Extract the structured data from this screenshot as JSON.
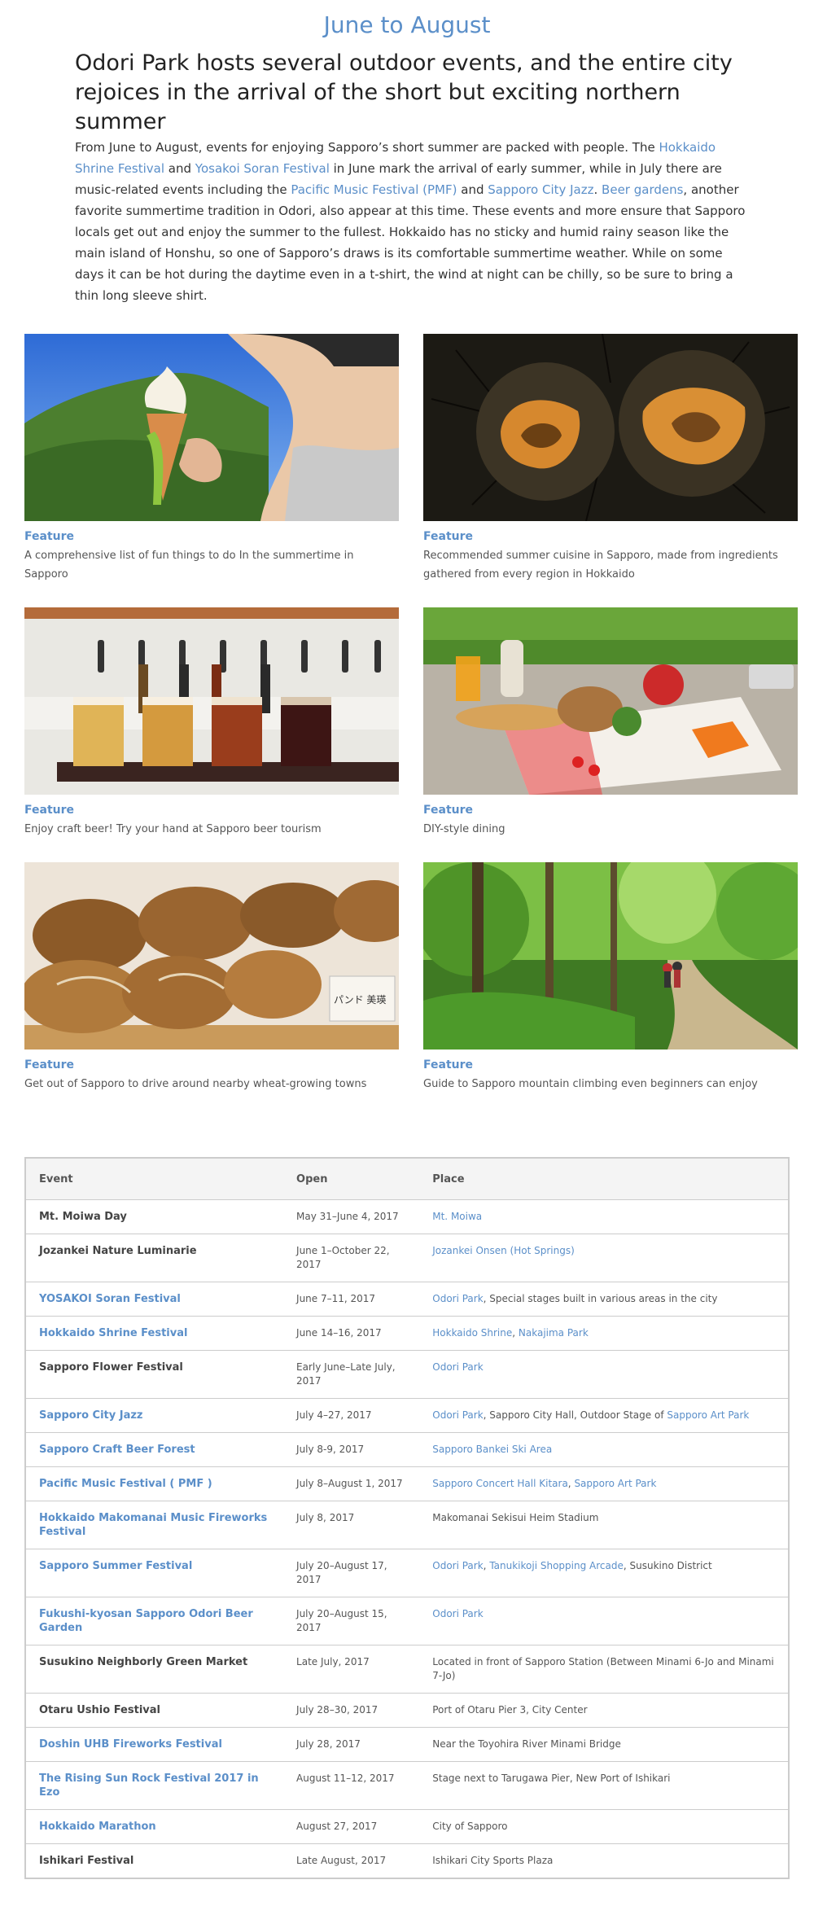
{
  "title": "June to August",
  "headline": "Odori Park hosts several outdoor events, and the entire city rejoices in the arrival of the short but exciting northern summer",
  "intro": [
    {
      "t": "From June to August, events for enjoying Sapporo’s short summer are packed with people. The "
    },
    {
      "t": "Hokkaido Shrine Festival",
      "link": true
    },
    {
      "t": " and "
    },
    {
      "t": "Yosakoi Soran Festival",
      "link": true
    },
    {
      "t": " in June mark the arrival of early summer, while in July there are music-related events including the "
    },
    {
      "t": "Pacific Music Festival (PMF)",
      "link": true
    },
    {
      "t": " and "
    },
    {
      "t": "Sapporo City Jazz",
      "link": true
    },
    {
      "t": ". "
    },
    {
      "t": "Beer gardens",
      "link": true
    },
    {
      "t": ", another favorite summertime tradition in Odori, also appear at this time. These events and more ensure that Sapporo locals get out and enjoy the summer to the fullest. Hokkaido has no sticky and humid rainy season like the main island of Honshu, so one of Sapporo’s draws is its comfortable summertime weather. While on some days it can be hot during the daytime even in a t-shirt, the wind at night can be chilly, so be sure to bring a thin long sleeve shirt."
    }
  ],
  "features": [
    {
      "tag": "Feature",
      "desc": "A comprehensive list of fun things to do In the summertime in Sapporo",
      "image": "soft-serve-ice-cream-photo"
    },
    {
      "tag": "Feature",
      "desc": "Recommended summer cuisine in Sapporo, made from ingredients gathered from every region in Hokkaido",
      "image": "sea-urchin-photo"
    },
    {
      "tag": "Feature",
      "desc": "Enjoy craft beer! Try your hand at Sapporo beer tourism",
      "image": "craft-beer-photo"
    },
    {
      "tag": "Feature",
      "desc": "DIY-style dining",
      "image": "picnic-food-photo"
    },
    {
      "tag": "Feature",
      "desc": "Get out of Sapporo to drive around nearby wheat-growing towns",
      "image": "bread-loaves-photo",
      "sign_text": "パンド 美瑛"
    },
    {
      "tag": "Feature",
      "desc": "Guide to Sapporo mountain climbing even beginners can enjoy",
      "image": "forest-trail-photo"
    }
  ],
  "table": {
    "headers": [
      "Event",
      "Open",
      "Place"
    ],
    "rows": [
      {
        "event": "Mt. Moiwa Day",
        "event_link": false,
        "open": "May 31–June 4, 2017",
        "place": [
          {
            "t": "Mt. Moiwa",
            "link": true
          }
        ]
      },
      {
        "event": "Jozankei Nature Luminarie",
        "event_link": false,
        "open": "June 1–October 22, 2017",
        "place": [
          {
            "t": "Jozankei Onsen (Hot Springs)",
            "link": true
          }
        ]
      },
      {
        "event": "YOSAKOI Soran Festival",
        "event_link": true,
        "open": "June 7–11, 2017",
        "place": [
          {
            "t": "Odori Park",
            "link": true
          },
          {
            "t": ", Special stages built in various areas in the city"
          }
        ]
      },
      {
        "event": "Hokkaido Shrine Festival",
        "event_link": true,
        "open": "June 14–16, 2017",
        "place": [
          {
            "t": "Hokkaido Shrine",
            "link": true
          },
          {
            "t": ", "
          },
          {
            "t": "Nakajima Park",
            "link": true
          }
        ]
      },
      {
        "event": "Sapporo Flower Festival",
        "event_link": false,
        "open": "Early June–Late July, 2017",
        "place": [
          {
            "t": "Odori Park",
            "link": true
          }
        ]
      },
      {
        "event": "Sapporo City Jazz",
        "event_link": true,
        "open": "July 4–27, 2017",
        "place": [
          {
            "t": "Odori Park",
            "link": true
          },
          {
            "t": ", Sapporo City Hall, Outdoor Stage of "
          },
          {
            "t": "Sapporo Art Park",
            "link": true
          }
        ]
      },
      {
        "event": "Sapporo Craft Beer Forest",
        "event_link": true,
        "open": "July 8-9, 2017",
        "place": [
          {
            "t": "Sapporo Bankei Ski Area",
            "link": true
          }
        ]
      },
      {
        "event": "Pacific Music Festival ( PMF )",
        "event_link": true,
        "open": "July 8–August 1, 2017",
        "place": [
          {
            "t": "Sapporo Concert Hall Kitara",
            "link": true
          },
          {
            "t": ", "
          },
          {
            "t": "Sapporo Art Park",
            "link": true
          }
        ]
      },
      {
        "event": "Hokkaido Makomanai Music Fireworks Festival",
        "event_link": true,
        "open": "July 8, 2017",
        "place": [
          {
            "t": "Makomanai Sekisui Heim Stadium"
          }
        ]
      },
      {
        "event": "Sapporo Summer Festival",
        "event_link": true,
        "open": "July 20–August 17, 2017",
        "place": [
          {
            "t": "Odori Park",
            "link": true
          },
          {
            "t": ", "
          },
          {
            "t": "Tanukikoji Shopping Arcade",
            "link": true
          },
          {
            "t": ", Susukino District"
          }
        ]
      },
      {
        "event": "Fukushi-kyosan Sapporo Odori Beer Garden",
        "event_link": true,
        "open": "July 20–August 15, 2017",
        "place": [
          {
            "t": "Odori Park",
            "link": true
          }
        ]
      },
      {
        "event": "Susukino Neighborly Green Market",
        "event_link": false,
        "open": "Late July, 2017",
        "place": [
          {
            "t": "Located in front of Sapporo Station (Between Minami 6-Jo and Minami 7-Jo)"
          }
        ]
      },
      {
        "event": "Otaru Ushio Festival",
        "event_link": false,
        "open": "July 28–30, 2017",
        "place": [
          {
            "t": "Port of Otaru Pier 3, City Center"
          }
        ]
      },
      {
        "event": "Doshin UHB Fireworks Festival",
        "event_link": true,
        "open": "July 28, 2017",
        "place": [
          {
            "t": "Near the Toyohira River Minami Bridge"
          }
        ]
      },
      {
        "event": "The Rising Sun Rock Festival 2017 in Ezo",
        "event_link": true,
        "open": "August 11–12, 2017",
        "place": [
          {
            "t": "Stage next to Tarugawa Pier, New Port of Ishikari"
          }
        ]
      },
      {
        "event": "Hokkaido Marathon",
        "event_link": true,
        "open": "August 27, 2017",
        "place": [
          {
            "t": "City of Sapporo"
          }
        ]
      },
      {
        "event": "Ishikari Festival",
        "event_link": false,
        "open": "Late August, 2017",
        "place": [
          {
            "t": "Ishikari City Sports Plaza"
          }
        ]
      }
    ]
  },
  "colors": {
    "accent": "#5b8fc9",
    "text": "#333333",
    "border": "#cccccc",
    "header_bg": "#f4f4f4"
  }
}
